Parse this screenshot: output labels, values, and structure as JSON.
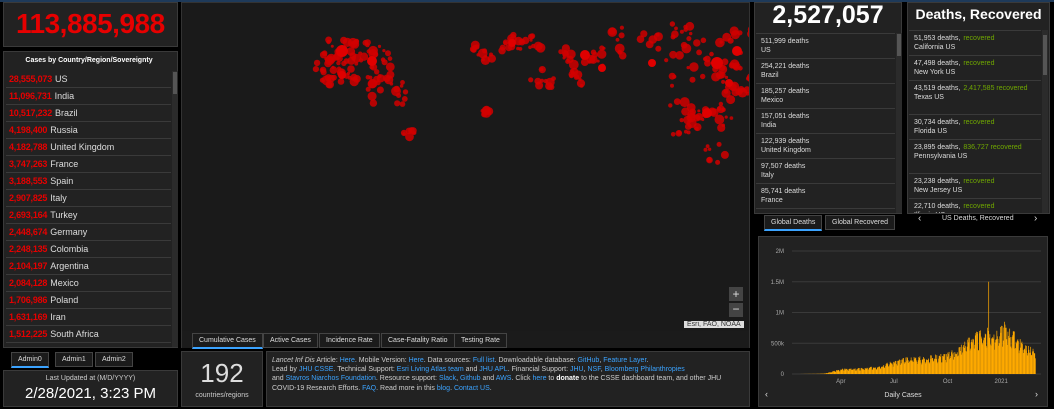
{
  "header": {
    "total_label": "Total Cases",
    "total": "113,885,988"
  },
  "list_title": "Cases by Country/Region/Sovereignty",
  "countries": [
    {
      "value": "28,555,073",
      "name": "US"
    },
    {
      "value": "11,096,731",
      "name": "India"
    },
    {
      "value": "10,517,232",
      "name": "Brazil"
    },
    {
      "value": "4,198,400",
      "name": "Russia"
    },
    {
      "value": "4,182,788",
      "name": "United Kingdom"
    },
    {
      "value": "3,747,263",
      "name": "France"
    },
    {
      "value": "3,188,553",
      "name": "Spain"
    },
    {
      "value": "2,907,825",
      "name": "Italy"
    },
    {
      "value": "2,693,164",
      "name": "Turkey"
    },
    {
      "value": "2,448,674",
      "name": "Germany"
    },
    {
      "value": "2,248,135",
      "name": "Colombia"
    },
    {
      "value": "2,104,197",
      "name": "Argentina"
    },
    {
      "value": "2,084,128",
      "name": "Mexico"
    },
    {
      "value": "1,706,986",
      "name": "Poland"
    },
    {
      "value": "1,631,169",
      "name": "Iran"
    },
    {
      "value": "1,512,225",
      "name": "South Africa"
    }
  ],
  "admin_tabs": [
    "Admin0",
    "Admin1",
    "Admin2"
  ],
  "last_updated": {
    "label": "Last Updated at (M/D/YYYY)",
    "value": "2/28/2021, 3:23 PM"
  },
  "map": {
    "attribution": "Esri, FAO, NOAA",
    "zoom_in": "+",
    "zoom_out": "−",
    "tabs": [
      "Cumulative Cases",
      "Active Cases",
      "Incidence Rate",
      "Case-Fatality Ratio",
      "Testing Rate"
    ]
  },
  "count": {
    "value": "192",
    "label": "countries/regions"
  },
  "info_text": {
    "p1": "Lancet Inf Dis",
    "p2": " Article: ",
    "here1": "Here",
    "p3": ". Mobile Version: ",
    "here2": "Here",
    "p4": ". Data sources: ",
    "fulllist": "Full list",
    "p5": ". Downloadable database: ",
    "github": "GitHub",
    "p6": ", ",
    "featurelayer": "Feature Layer",
    "p7": ".",
    "p8": "Lead by ",
    "jhucsse": "JHU CSSE",
    "p9": ". Technical Support: ",
    "esri": "Esri Living Atlas team",
    "p10": " and ",
    "jhuapl": "JHU APL",
    "p11": ". Financial Support: ",
    "jhu": "JHU",
    "p12": ", ",
    "nsf": "NSF",
    "p13": ", ",
    "bloomberg": "Bloomberg Philanthropies",
    "p14": " and ",
    "stavros": "Stavros Niarchos Foundation",
    "p15": ". Resource support: ",
    "slack": "Slack",
    "p16": ", ",
    "github2": "Github",
    "p17": " and ",
    "aws": "AWS",
    "p18": ". Click ",
    "here3": "here",
    "p19": " to ",
    "donate": "donate",
    "p20": " to the CSSE dashboard team, and other JHU COVID-19 Research Efforts. ",
    "faq": "FAQ",
    "p21": ". Read more in this ",
    "blog": "blog",
    "p22": ". ",
    "contact": "Contact US",
    "p23": "."
  },
  "deaths": {
    "total": "2,527,057",
    "rows": [
      {
        "value": "511,999 deaths",
        "name": "US"
      },
      {
        "value": "254,221 deaths",
        "name": "Brazil"
      },
      {
        "value": "185,257 deaths",
        "name": "Mexico"
      },
      {
        "value": "157,051 deaths",
        "name": "India"
      },
      {
        "value": "122,939 deaths",
        "name": "United Kingdom"
      },
      {
        "value": "97,507 deaths",
        "name": "Italy"
      },
      {
        "value": "85,741 deaths",
        "name": "France"
      }
    ],
    "tabs": [
      "Global Deaths",
      "Global Recovered"
    ]
  },
  "us_panel": {
    "title": "Deaths, Recovered",
    "rows": [
      {
        "deaths": "51,953 deaths,",
        "recovered": "recovered",
        "name": "California US"
      },
      {
        "deaths": "47,498 deaths,",
        "recovered": "recovered",
        "name": "New York US"
      },
      {
        "deaths": "43,519 deaths,",
        "recovered": "2,417,585 recovered",
        "name": "Texas US"
      },
      {
        "deaths": "30,734 deaths,",
        "recovered": "recovered",
        "name": "Florida US"
      },
      {
        "deaths": "23,895 deaths,",
        "recovered": "836,727 recovered",
        "name": "Pennsylvania US"
      },
      {
        "deaths": "23,238 deaths,",
        "recovered": "recovered",
        "name": "New Jersey US"
      },
      {
        "deaths": "22,710 deaths,",
        "recovered": "recovered",
        "name": "Illinois US"
      }
    ],
    "nav_label": "US Deaths, Recovered",
    "prev": "‹",
    "next": "›"
  },
  "chart_data": {
    "type": "bar",
    "title": "",
    "xlabel": "Daily Cases",
    "ylabel": "",
    "yticks": [
      "0",
      "500k",
      "1M",
      "1.5M",
      "2M"
    ],
    "xticks": [
      "Apr",
      "Jul",
      "Oct",
      "2021"
    ],
    "ylim": [
      0,
      2000000
    ],
    "bar_color": "#ffaa00",
    "series_note": "daily new cases, Jan 22 2020 – Feb 28 2021",
    "weekly_x": [
      "2020-01-22",
      "2020-02-05",
      "2020-02-19",
      "2020-03-04",
      "2020-03-18",
      "2020-04-01",
      "2020-04-15",
      "2020-04-29",
      "2020-05-13",
      "2020-05-27",
      "2020-06-10",
      "2020-06-24",
      "2020-07-08",
      "2020-07-22",
      "2020-08-05",
      "2020-08-19",
      "2020-09-02",
      "2020-09-16",
      "2020-09-30",
      "2020-10-14",
      "2020-10-28",
      "2020-11-11",
      "2020-11-25",
      "2020-12-09",
      "2020-12-23",
      "2021-01-06",
      "2021-01-20",
      "2021-02-03",
      "2021-02-17",
      "2021-02-28"
    ],
    "values": [
      500,
      2000,
      3000,
      8000,
      40000,
      75000,
      82000,
      85000,
      90000,
      110000,
      135000,
      180000,
      210000,
      240000,
      260000,
      250000,
      270000,
      290000,
      310000,
      360000,
      470000,
      580000,
      620000,
      660000,
      620000,
      740000,
      640000,
      500000,
      410000,
      370000
    ],
    "spike": {
      "date": "2020-12-10",
      "value": 1500000
    }
  }
}
